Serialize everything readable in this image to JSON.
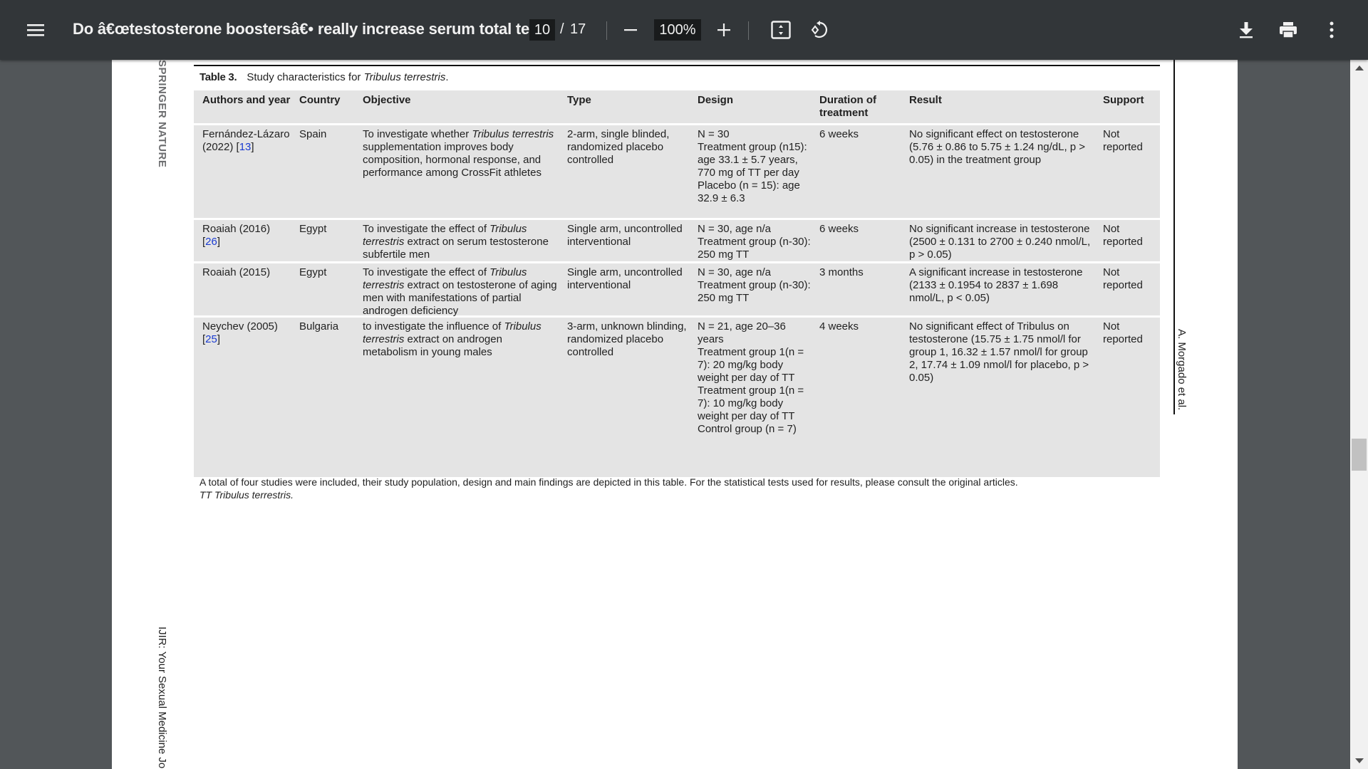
{
  "toolbar": {
    "title": "Do â€œtestosterone boostersâ€• really increase serum total te...",
    "current_page": "10",
    "page_separator": "/",
    "total_pages": "17",
    "zoom_level": "100%",
    "icons": {
      "menu": "menu-icon",
      "zoom_out": "minus-icon",
      "zoom_in": "plus-icon",
      "fit": "fit-to-page-icon",
      "rotate": "rotate-icon",
      "download": "download-icon",
      "print": "print-icon",
      "more": "more-vert-icon"
    }
  },
  "page": {
    "side_publisher": "SPRINGER NATURE",
    "side_journal": "IJIR: Your Sexual Medicine Jo",
    "side_author": "A. Morgado et al.",
    "caption": {
      "label": "Table 3.",
      "text": "Study characteristics for ",
      "italic": "Tribulus terrestris",
      "end": "."
    },
    "table": {
      "headers": [
        "Authors and year",
        "Country",
        "Objective",
        "Type",
        "Design",
        "Duration of treatment",
        "Result",
        "Support"
      ],
      "rows": [
        {
          "author": "Fernández-Lázaro (2022)",
          "ref": "13",
          "country": "Spain",
          "objective_pre": "To investigate whether ",
          "objective_it": "Tribulus terrestris",
          "objective_post": " supplementation improves body composition, hormonal response, and performance among CrossFit athletes",
          "type": "2-arm, single blinded, randomized placebo controlled",
          "design": [
            "N = 30",
            "Treatment group (n15): age 33.1 ± 5.7 years, 770 mg of TT per day",
            "Placebo (n = 15): age 32.9 ± 6.3"
          ],
          "duration": "6 weeks",
          "result": "No significant effect on testosterone (5.76 ± 0.86 to 5.75 ± 1.24 ng/dL, p > 0.05) in the treatment group",
          "support": "Not reported"
        },
        {
          "author": "Roaiah (2016)",
          "ref": "26",
          "country": "Egypt",
          "objective_pre": "To investigate the effect of ",
          "objective_it": "Tribulus terrestris",
          "objective_post": " extract on serum testosterone subfertile men",
          "type": "Single arm, uncontrolled interventional",
          "design": [
            "N = 30, age n/a",
            "Treatment group (n-30): 250 mg TT"
          ],
          "duration": "6 weeks",
          "result": "No significant increase in testosterone (2500 ± 0.131 to 2700 ± 0.240 nmol/L, p > 0.05)",
          "support": "Not reported"
        },
        {
          "author": "Roaiah (2015)",
          "ref": "",
          "country": "Egypt",
          "objective_pre": "To investigate the effect of ",
          "objective_it": "Tribulus terrestris",
          "objective_post": " extract on testosterone of aging men with manifestations of partial androgen deficiency",
          "type": "Single arm, uncontrolled interventional",
          "design": [
            "N = 30, age n/a",
            "Treatment group (n-30): 250 mg TT"
          ],
          "duration": "3 months",
          "result": "A significant increase in testosterone (2133 ± 0.1954 to 2837 ± 1.698 nmol/L, p < 0.05)",
          "support": "Not reported"
        },
        {
          "author": "Neychev (2005)",
          "ref": "25",
          "country": "Bulgaria",
          "objective_pre": "to investigate the influence of ",
          "objective_it": "Tribulus terrestris",
          "objective_post": " extract on androgen metabolism in young males",
          "type": "3-arm, unknown blinding, randomized placebo controlled",
          "design": [
            "N = 21, age 20–36 years",
            "Treatment group 1(n = 7): 20 mg/kg body weight per day of TT",
            "Treatment group 1(n = 7): 10 mg/kg body weight per day of TT",
            "Control group (n = 7)"
          ],
          "duration": "4 weeks",
          "result": "No significant effect of Tribulus on testosterone (15.75 ± 1.75 nmol/l for group 1, 16.32 ± 1.57 nmol/l for group 2, 17.74 ± 1.09 nmol/l for placebo, p > 0.05)",
          "support": "Not reported"
        }
      ]
    },
    "footnote": {
      "line1": "A total of four studies were included, their study population, design and main findings are depicted in this table. For the statistical tests used for results, please consult the original articles.",
      "line2": "TT Tribulus terrestris."
    }
  }
}
